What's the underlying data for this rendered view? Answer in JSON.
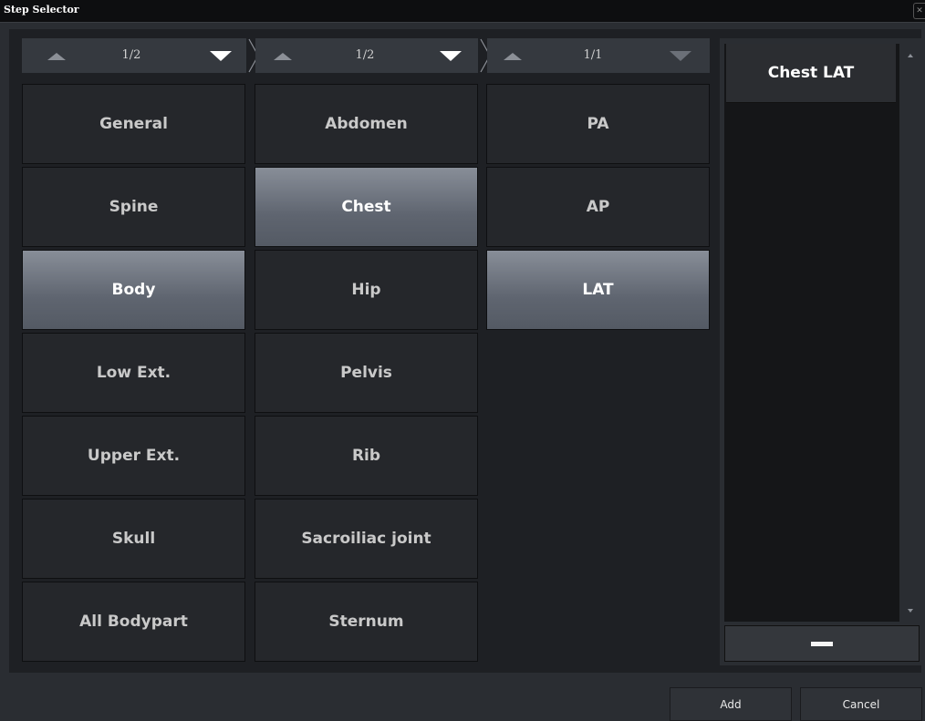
{
  "window": {
    "title": "Step Selector"
  },
  "pagers": [
    {
      "page": "1/2"
    },
    {
      "page": "1/2"
    },
    {
      "page": "1/1"
    }
  ],
  "columns": {
    "bodypart": [
      "General",
      "Spine",
      "Body",
      "Low Ext.",
      "Upper Ext.",
      "Skull",
      "All Bodypart"
    ],
    "region": [
      "Abdomen",
      "Chest",
      "Hip",
      "Pelvis",
      "Rib",
      "Sacroiliac joint",
      "Sternum"
    ],
    "view": [
      "PA",
      "AP",
      "LAT"
    ]
  },
  "selected_list": [
    "Chest LAT"
  ],
  "buttons": {
    "add": "Add",
    "cancel": "Cancel"
  },
  "colors": {
    "selected_tile": "#6a707a",
    "tile": "#25272b",
    "background": "#1e2024"
  }
}
